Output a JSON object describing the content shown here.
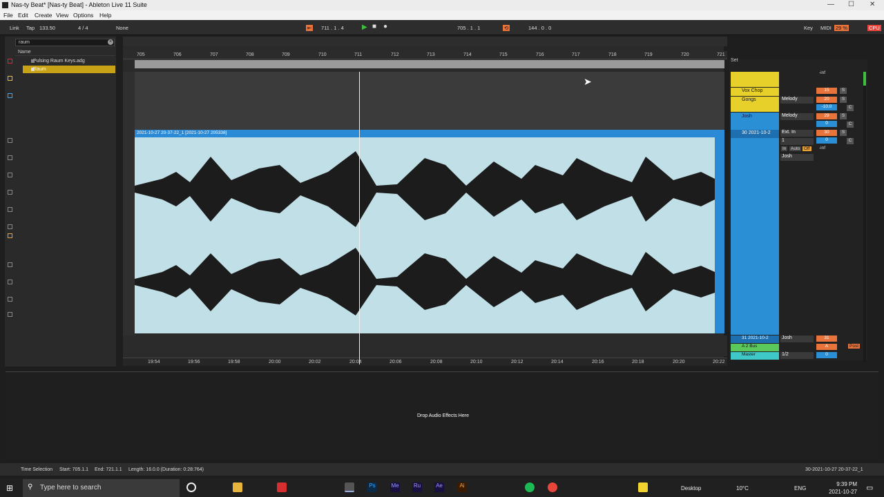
{
  "window": {
    "title": "Nas-ty Beat* [Nas-ty Beat] - Ableton Live 11 Suite",
    "controls": [
      "—",
      "☐",
      "✕"
    ]
  },
  "menu": [
    "File",
    "Edit",
    "Create",
    "View",
    "Options",
    "Help"
  ],
  "control_bar": {
    "link": "Link",
    "tap": "Tap",
    "tempo": "133.50",
    "signature": "4 / 4",
    "quant": "None",
    "arr_pos": "711 .  1 .  4",
    "loop_start": "705 .  1 .  1",
    "loop_len": "144 .  0 .  0",
    "key": "Key",
    "midi": "MIDI",
    "cpu": "29 %",
    "cpu_label": "CPU"
  },
  "browser": {
    "search": "raum",
    "col_name": "Name",
    "items": [
      "Pulsing Raum Keys.adg",
      "Raum"
    ]
  },
  "ruler_bars": [
    "705",
    "706",
    "707",
    "708",
    "709",
    "710",
    "711",
    "712",
    "713",
    "714",
    "715",
    "716",
    "717",
    "718",
    "719",
    "720",
    "721"
  ],
  "time_marks": [
    "19:54",
    "19:56",
    "19:58",
    "20:00",
    "20:02",
    "20:04",
    "20:06",
    "20:08",
    "20:10",
    "20:12",
    "20:14",
    "20:16",
    "20:18",
    "20:20",
    "20:22"
  ],
  "clip": {
    "name": "2021-10-27 20-37-22_1 [2021-10-27 205338]"
  },
  "mixer": {
    "set": "Set",
    "top_val": "-inf",
    "tracks": [
      {
        "name": "Vox Chop",
        "input": "",
        "vol": "15",
        "color": "#e8d02a"
      },
      {
        "name": "Gongs",
        "input": "Melody",
        "vol": "20",
        "vol2": "-10.0",
        "color": "#e8d02a"
      },
      {
        "name": "Josh",
        "input": "Melody",
        "vol": "29",
        "vol2": "0",
        "color": "#2a8fd4"
      },
      {
        "name": "30 2021-10-2",
        "input": "Ext. In",
        "in_ch": "1",
        "vol": "30",
        "vol2": "0",
        "color": "#2a8fd4"
      }
    ],
    "monitor": [
      "In",
      "Auto",
      "Off"
    ],
    "inf": "-inf",
    "route": "Josh",
    "return_tracks": [
      {
        "name": "31 2021-10-2",
        "route": "Josh",
        "vol": "31"
      },
      {
        "name": "A 2 Bus",
        "vol": "A"
      },
      {
        "name": "Master",
        "route": "1/2",
        "vol": "0"
      }
    ],
    "post": "Post",
    "solo": "S",
    "cue": "C"
  },
  "device_view": {
    "drop": "Drop Audio Effects Here"
  },
  "status": {
    "label": "Time Selection",
    "start": "Start: 705.1.1",
    "end": "End: 721.1.1",
    "length": "Length: 16.0.0 (Duration: 0:28:764)",
    "clip": "30-2021-10-27 20-37-22_1"
  },
  "taskbar": {
    "search": "Type here to search",
    "desktop": "Desktop",
    "temp": "10°C",
    "lang": "ENG",
    "time": "9:39 PM",
    "date": "2021-10-27"
  }
}
